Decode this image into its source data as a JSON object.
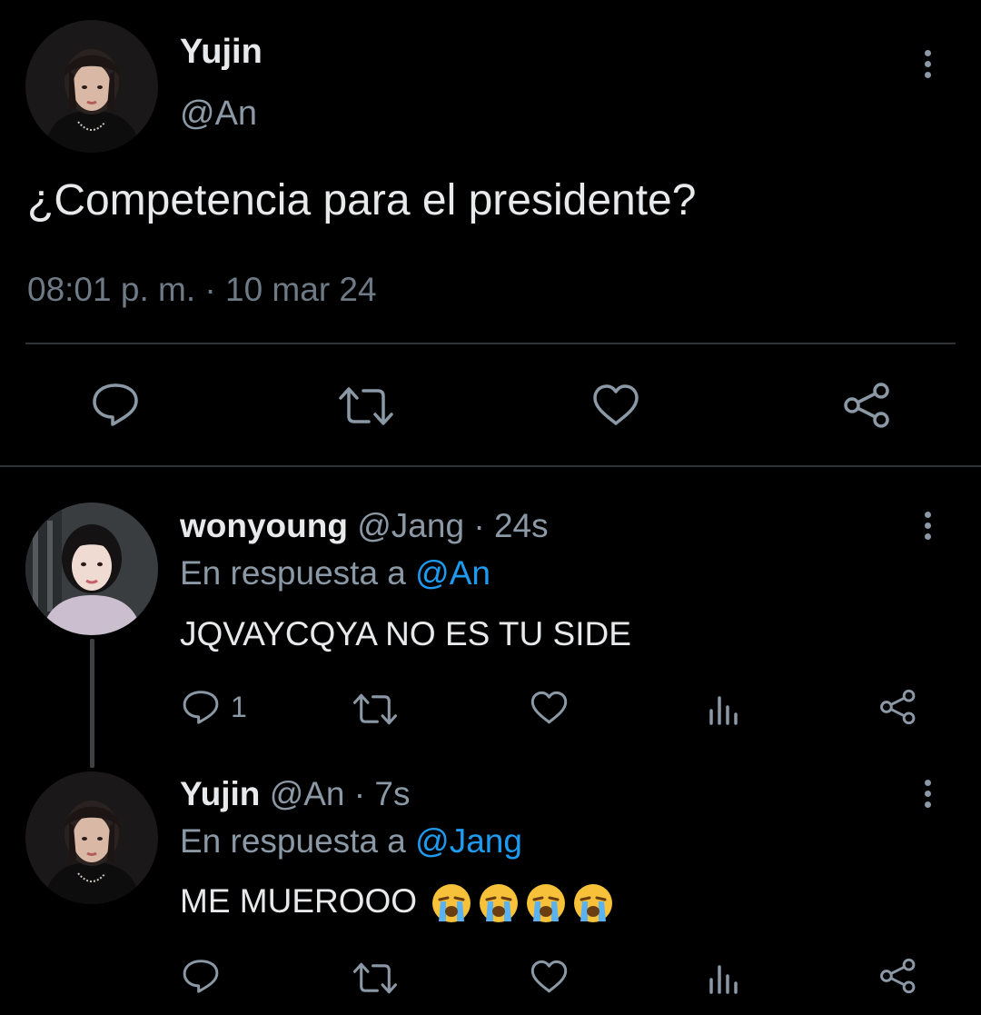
{
  "main_tweet": {
    "author_name": "Yujin",
    "author_handle": "@An",
    "text": "¿Competencia para el presidente?",
    "timestamp": "08:01 p. m. · 10 mar 24",
    "actions": [
      "reply-icon",
      "retweet-icon",
      "like-icon",
      "share-icon"
    ]
  },
  "replies": [
    {
      "author_name": "wonyoung",
      "author_handle": "@Jang",
      "separator": "·",
      "age": "24s",
      "reply_prefix": "En respuesta a",
      "reply_to": "@An",
      "text": "JQVAYCQYA NO ES TU SIDE",
      "reply_count": "1",
      "actions": [
        "reply-icon",
        "retweet-icon",
        "like-icon",
        "views-icon",
        "share-icon"
      ]
    },
    {
      "author_name": "Yujin",
      "author_handle": "@An",
      "separator": "·",
      "age": "7s",
      "reply_prefix": "En respuesta a",
      "reply_to": "@Jang",
      "text": "ME MUEROOO",
      "emoji": [
        "loudly-crying-face",
        "loudly-crying-face",
        "loudly-crying-face",
        "loudly-crying-face"
      ],
      "actions": [
        "reply-icon",
        "retweet-icon",
        "like-icon",
        "views-icon",
        "share-icon"
      ]
    }
  ],
  "colors": {
    "background": "#000000",
    "primary_text": "#e7e9ea",
    "secondary_text": "#8b98a5",
    "link": "#1d9bf0",
    "divider": "#2f3336"
  }
}
